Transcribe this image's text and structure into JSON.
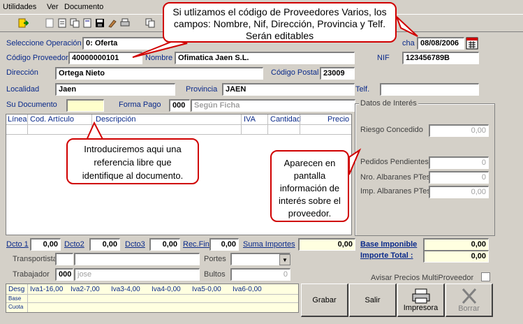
{
  "menu": {
    "utilidades": "Utilidades",
    "ver": "Ver",
    "documento": "Documento"
  },
  "form": {
    "seleccione_operacion_label": "Seleccione Operación",
    "seleccione_operacion_value": "0: Oferta",
    "fecha_label": "cha",
    "fecha_value": "08/08/2006",
    "codigo_proveedor_label": "Código Proveedor",
    "codigo_proveedor_value": "40000000101",
    "nombre_label": "Nombre",
    "nombre_value": "Ofimatica Jaen S.L.",
    "nif_label": "NIF",
    "nif_value": "123456789B",
    "direccion_label": "Dirección",
    "direccion_value": "Ortega Nieto",
    "codigo_postal_label": "Código Postal",
    "codigo_postal_value": "23009",
    "localidad_label": "Localidad",
    "localidad_value": "Jaen",
    "provincia_label": "Provincia",
    "provincia_value": "JAEN",
    "telf_label": "Telf.",
    "telf_value": "",
    "su_documento_label": "Su Documento",
    "su_documento_value": "",
    "forma_pago_label": "Forma Pago",
    "forma_pago_code": "000",
    "forma_pago_value": "Según Ficha"
  },
  "grid": {
    "columns": [
      "Línea",
      "Cod. Artículo",
      "Descripción",
      "IVA",
      "Cantidad",
      "Precio"
    ]
  },
  "interes": {
    "title": "Datos de Interés",
    "riesgo_label": "Riesgo Concedido",
    "riesgo_value": "0,00",
    "pedidos_label": "Pedidos Pendientes",
    "pedidos_value": "0",
    "albaranes_label": "Nro. Albaranes PTes.",
    "albaranes_value": "0",
    "imp_albaranes_label": "Imp. Albaranes PTes.",
    "imp_albaranes_value": "0,00"
  },
  "totals": {
    "dcto1_label": "Dcto 1",
    "dcto1_value": "0,00",
    "dcto2_label": "Dcto2",
    "dcto2_value": "0,00",
    "dcto3_label": "Dcto3",
    "dcto3_value": "0,00",
    "recfin_label": "Rec.Fin",
    "recfin_value": "0,00",
    "suma_label": "Suma Importes",
    "suma_value": "0,00",
    "base_label": "Base Imponible",
    "base_value": "0,00",
    "importe_label": "Importe Total :",
    "importe_value": "0,00"
  },
  "misc": {
    "transportista_label": "Transportista",
    "portes_label": "Portes",
    "trabajador_label": "Trabajador",
    "trabajador_code": "000",
    "trabajador_value": "jose",
    "bultos_label": "Bultos",
    "bultos_value": "0",
    "avisar_label": "Avisar Precios MultiProveedor"
  },
  "taxes": {
    "headers": [
      "Desg",
      "Iva1-16,00",
      "Iva2-7,00",
      "Iva3-4,00",
      "Iva4-0,00",
      "Iva5-0,00",
      "Iva6-0,00"
    ],
    "row_base": "Base",
    "row_cuota": "Cuota"
  },
  "buttons": {
    "grabar": "Grabar",
    "salir": "Salir",
    "impresora": "Impresora",
    "borrar": "Borrar"
  },
  "callouts": {
    "top": "Si utlizamos el código de Proveedores Varios, los campos: Nombre, Nif, Dirección, Provincia y Telf. Serán editables",
    "left": "Introduciremos aqui una referencia libre que identifique al documento.",
    "right": "Aparecen en pantalla información de interés sobre el proveedor."
  },
  "icons": [
    "exit-icon",
    "new-doc-icon",
    "open-doc-icon",
    "copy-icon",
    "save-icon",
    "brush-icon",
    "print-icon",
    "copy2-icon",
    "calendar-icon"
  ]
}
